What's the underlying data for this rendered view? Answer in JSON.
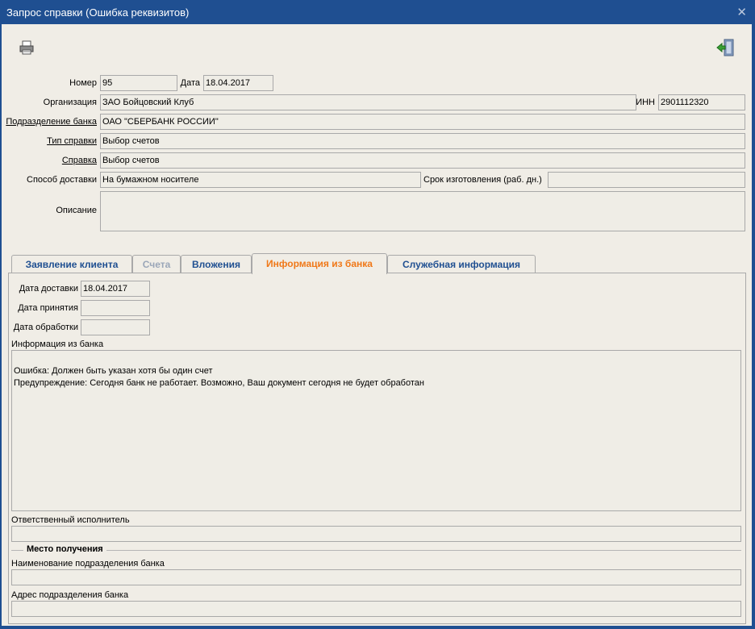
{
  "window": {
    "title": "Запрос справки (Ошибка реквизитов)"
  },
  "toolbar": {
    "print_icon": "printer-icon",
    "exit_icon": "exit-door-icon"
  },
  "form": {
    "number_label": "Номер",
    "number_value": "95",
    "date_label": "Дата",
    "date_value": "18.04.2017",
    "org_label": "Организация",
    "org_value": "ЗАО Бойцовский Клуб",
    "inn_label": "ИНН",
    "inn_value": "2901112320",
    "bank_unit_label": "Подразделение банка",
    "bank_unit_value": "ОАО \"СБЕРБАНК РОССИИ\"",
    "cert_type_label": "Тип справки",
    "cert_type_value": "Выбор счетов",
    "cert_label": "Справка",
    "cert_value": "Выбор счетов",
    "delivery_label": "Способ доставки",
    "delivery_value": "На бумажном носителе",
    "term_label": "Срок изготовления (раб. дн.)",
    "term_value": "",
    "desc_label": "Описание",
    "desc_value": ""
  },
  "tabs": [
    {
      "label": "Заявление клиента",
      "state": "normal"
    },
    {
      "label": "Счета",
      "state": "disabled"
    },
    {
      "label": "Вложения",
      "state": "normal"
    },
    {
      "label": "Информация из банка",
      "state": "active"
    },
    {
      "label": "Служебная информация",
      "state": "normal"
    }
  ],
  "bank_info": {
    "delivery_date_label": "Дата доставки",
    "delivery_date_value": "18.04.2017",
    "accept_date_label": "Дата принятия",
    "accept_date_value": "",
    "process_date_label": "Дата обработки",
    "process_date_value": "",
    "info_label": "Информация из банка",
    "info_text": "Ошибка: Должен быть указан хотя бы один счет\nПредупреждение: Сегодня банк не работает. Возможно, Ваш документ сегодня не будет обработан",
    "responsible_label": "Ответственный исполнитель",
    "responsible_value": "",
    "pickup_group_title": "Место получения",
    "unit_name_label": "Наименование подразделения банка",
    "unit_name_value": "",
    "unit_address_label": "Адрес подразделения банка",
    "unit_address_value": ""
  },
  "colors": {
    "titlebar": "#1f4f91",
    "tab_text": "#1f4f91",
    "active_tab_text": "#f07818",
    "client_bg": "#f0ede6"
  }
}
